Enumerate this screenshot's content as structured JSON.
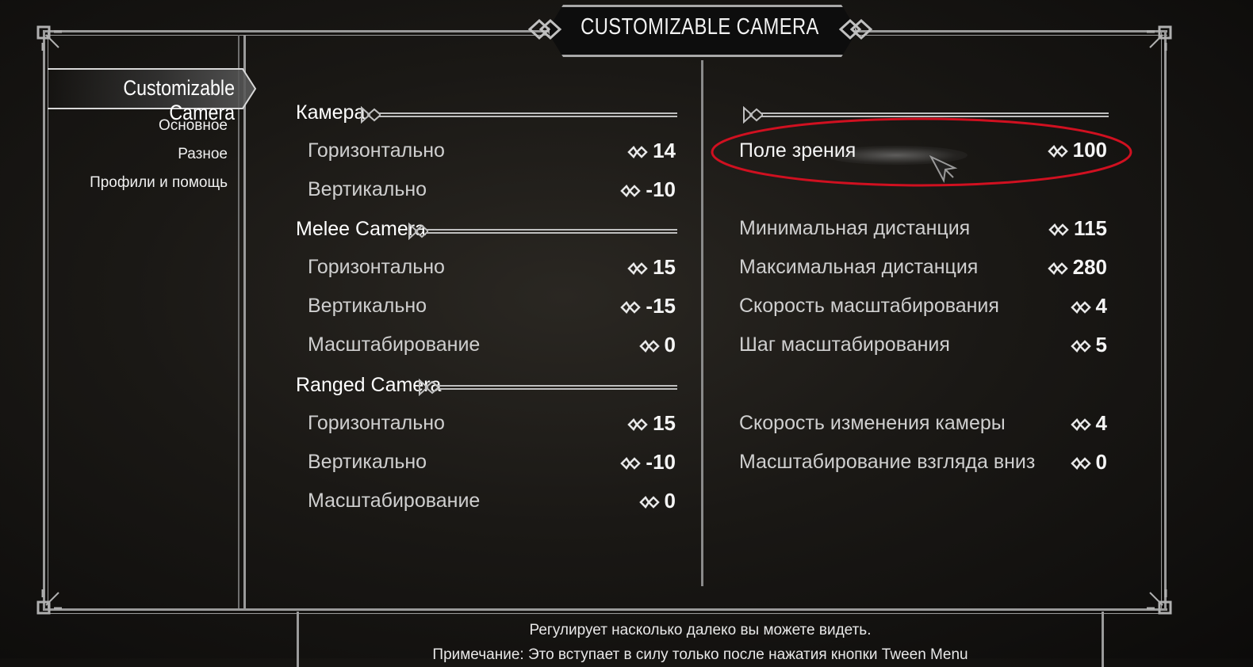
{
  "menu_title": "CUSTOMIZABLE CAMERA",
  "nav": {
    "active": "Customizable Camera",
    "items": [
      "Основное",
      "Разное",
      "Профили и помощь"
    ]
  },
  "left_column": {
    "sections": [
      {
        "header": "Камера",
        "options": [
          {
            "label": "Горизонтально",
            "value": "14"
          },
          {
            "label": "Вертикально",
            "value": "-10"
          }
        ]
      },
      {
        "header": "Melee Camera",
        "options": [
          {
            "label": "Горизонтально",
            "value": "15"
          },
          {
            "label": "Вертикально",
            "value": "-15"
          },
          {
            "label": "Масштабирование",
            "value": "0"
          }
        ]
      },
      {
        "header": "Ranged Camera",
        "options": [
          {
            "label": "Горизонтально",
            "value": "15"
          },
          {
            "label": "Вертикально",
            "value": "-10"
          },
          {
            "label": "Масштабирование",
            "value": "0"
          }
        ]
      }
    ]
  },
  "right_column": {
    "highlighted": {
      "label": "Поле зрения",
      "value": "100"
    },
    "group1": [
      {
        "label": "Минимальная дистанция",
        "value": "115"
      },
      {
        "label": "Максимальная дистанция",
        "value": "280"
      },
      {
        "label": "Скорость масштабирования",
        "value": "4"
      },
      {
        "label": "Шаг масштабирования",
        "value": "5"
      }
    ],
    "group2": [
      {
        "label": "Скорость изменения камеры",
        "value": "4"
      },
      {
        "label": "Масштабирование взгляда вниз",
        "value": "0"
      }
    ]
  },
  "description": {
    "line1": "Регулирует насколько далеко вы можете видеть.",
    "line2": "Примечание: Это вступает в силу только после нажатия кнопки Tween Menu"
  },
  "colors": {
    "highlight_ellipse": "#d01020",
    "frame": "#9a9a9a",
    "text_bright": "#f5f5f5",
    "text_dim": "#cfcfcf"
  },
  "icons": {
    "value_arrows": "left-right-arrows-icon",
    "header_ornament": "celtic-knot-ornament-icon",
    "corner": "corner-knot-icon",
    "cursor": "mouse-cursor-icon"
  }
}
